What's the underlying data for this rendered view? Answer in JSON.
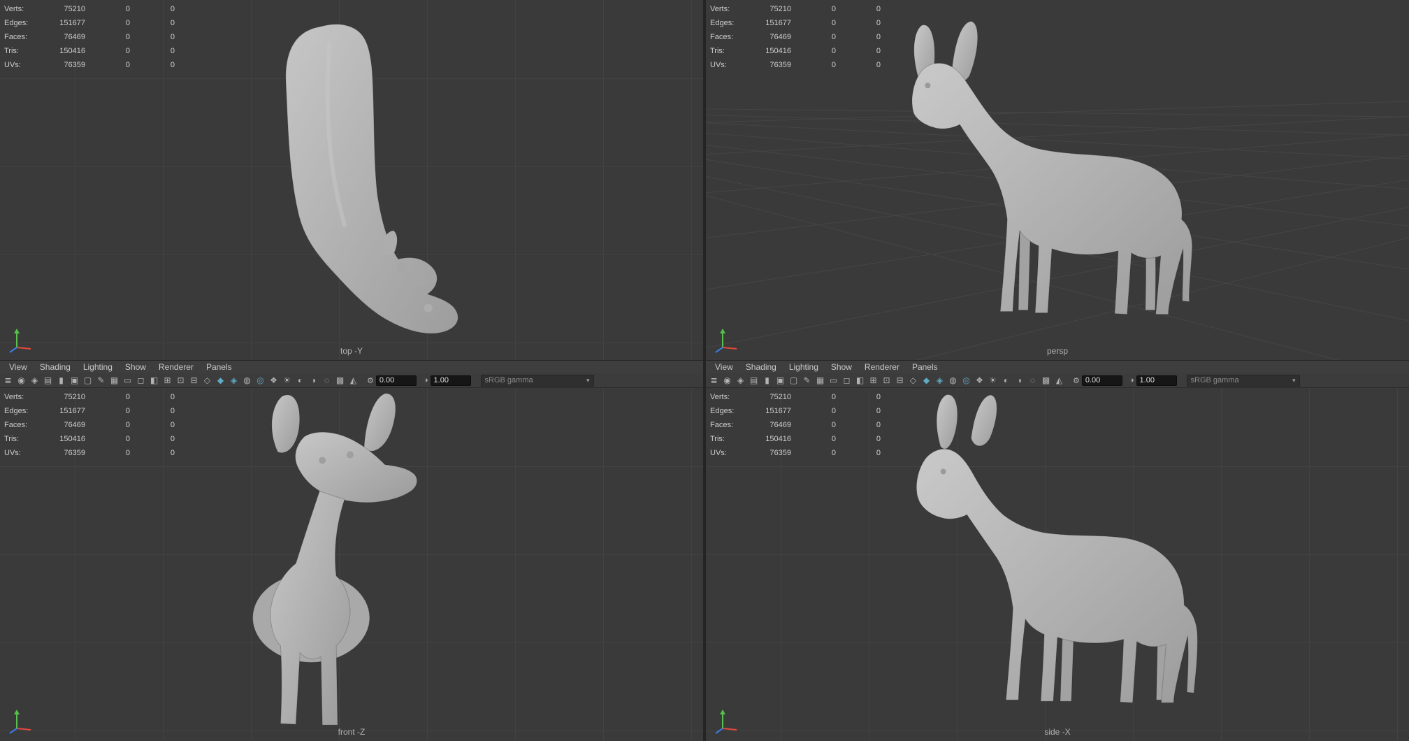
{
  "stats": {
    "rows": [
      {
        "label": "Verts:",
        "value": "75210",
        "c2": "0",
        "c3": "0"
      },
      {
        "label": "Edges:",
        "value": "151677",
        "c2": "0",
        "c3": "0"
      },
      {
        "label": "Faces:",
        "value": "76469",
        "c2": "0",
        "c3": "0"
      },
      {
        "label": "Tris:",
        "value": "150416",
        "c2": "0",
        "c3": "0"
      },
      {
        "label": "UVs:",
        "value": "76359",
        "c2": "0",
        "c3": "0"
      }
    ]
  },
  "panel_menu": {
    "items": [
      "View",
      "Shading",
      "Lighting",
      "Show",
      "Renderer",
      "Panels"
    ]
  },
  "toolbar": {
    "icons": [
      {
        "name": "menu-grip-icon",
        "glyph": "≣"
      },
      {
        "name": "select-camera-icon",
        "glyph": "◉"
      },
      {
        "name": "lock-camera-icon",
        "glyph": "◈"
      },
      {
        "name": "camera-attributes-icon",
        "glyph": "▤"
      },
      {
        "name": "bookmarks-icon",
        "glyph": "▮"
      },
      {
        "name": "image-plane-icon",
        "glyph": "▣"
      },
      {
        "name": "pan-zoom-icon",
        "glyph": "▢"
      },
      {
        "name": "grease-pencil-icon",
        "glyph": "✎"
      },
      {
        "name": "grid-toggle-icon",
        "glyph": "▦"
      },
      {
        "name": "film-gate-icon",
        "glyph": "▭"
      },
      {
        "name": "resolution-gate-icon",
        "glyph": "◻"
      },
      {
        "name": "gate-mask-icon",
        "glyph": "◧"
      },
      {
        "name": "field-chart-icon",
        "glyph": "⊞"
      },
      {
        "name": "safe-action-icon",
        "glyph": "⊡"
      },
      {
        "name": "safe-title-icon",
        "glyph": "⊟"
      },
      {
        "name": "wireframe-mode-icon",
        "glyph": "◇"
      },
      {
        "name": "shaded-mode-icon",
        "glyph": "◆",
        "accent": true
      },
      {
        "name": "textured-mode-icon",
        "glyph": "◈",
        "accent": true
      },
      {
        "name": "use-default-material-icon",
        "glyph": "◍"
      },
      {
        "name": "wireframe-on-shaded-icon",
        "glyph": "◎",
        "accent": true
      },
      {
        "name": "xray-mode-icon",
        "glyph": "❖"
      },
      {
        "name": "all-lights-icon",
        "glyph": "☀"
      },
      {
        "name": "shadows-icon",
        "glyph": "◐"
      },
      {
        "name": "occlusion-icon",
        "glyph": "◑"
      },
      {
        "name": "motion-blur-icon",
        "glyph": "◌"
      },
      {
        "name": "multisample-icon",
        "glyph": "▩"
      },
      {
        "name": "isolate-select-icon",
        "glyph": "◭"
      }
    ],
    "exposure": {
      "icon": "⚙",
      "value": "0.00"
    },
    "gamma": {
      "icon": "◑",
      "value": "1.00"
    },
    "view_transform": {
      "label": "sRGB gamma",
      "arrow": "▾"
    }
  },
  "viewports": {
    "top_left": {
      "label": "top -Y"
    },
    "top_right": {
      "label": "persp"
    },
    "bottom_left": {
      "label": "front -Z"
    },
    "bottom_right": {
      "label": "side -X"
    }
  },
  "colors": {
    "viewport_bg": "#3a3a3a",
    "grid_line": "#424242",
    "model_gray": "#b6b6b6",
    "accent_teal": "#62aac5",
    "axis_x": "#e2493b",
    "axis_y": "#58c04d",
    "axis_z": "#3b7de2"
  }
}
